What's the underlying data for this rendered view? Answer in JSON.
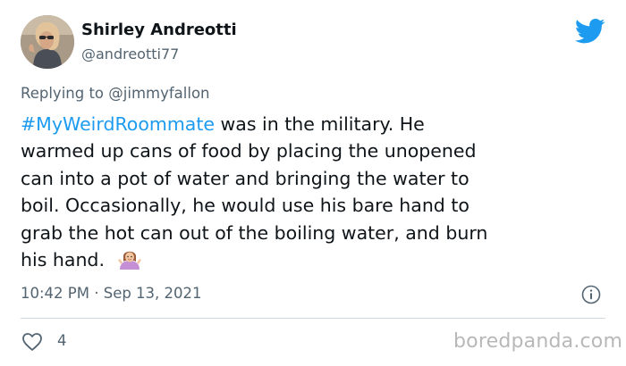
{
  "user": {
    "display_name": "Shirley Andreotti",
    "handle": "@andreotti77"
  },
  "reply": {
    "prefix": "Replying to ",
    "mention": "@jimmyfallon"
  },
  "tweet": {
    "hashtag": "#MyWeirdRoommate",
    "line1_rest": " was in the military.  He",
    "line2": "warmed up cans of food by placing the unopened",
    "line3": "can into a pot of water and bringing the water to",
    "line4": "boil.  Occasionally, he would use his bare hand to",
    "line5": "grab the hot can out of the boiling water, and burn",
    "line6": "his hand.",
    "emoji": "person-shrugging"
  },
  "meta": {
    "timestamp": "10:42 PM · Sep 13, 2021"
  },
  "actions": {
    "likes": "4"
  },
  "watermark": "boredpanda.com",
  "colors": {
    "accent": "#1d9bf0",
    "secondary_text": "#536471",
    "divider": "#cfd9de"
  },
  "icons": [
    "twitter-bird-icon",
    "info-icon",
    "heart-icon",
    "shrug-emoji-icon"
  ]
}
